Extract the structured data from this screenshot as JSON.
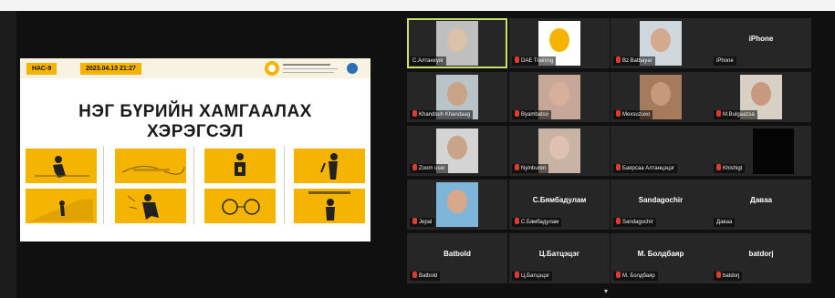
{
  "slide": {
    "tag_left": "НАС-9",
    "tag_date": "2023.04.13 21:27",
    "title_line1": "НЭГ БҮРИЙН ХАМГААЛАХ",
    "title_line2": "ХЭРЭГСЭЛ"
  },
  "participants": [
    {
      "label": "С.Алтанхуяг",
      "muted": false,
      "video": true
    },
    {
      "label": "DAE Training",
      "muted": true,
      "video": true
    },
    {
      "label": "Bz Batbayar",
      "muted": true,
      "video": true
    },
    {
      "label": "iPhone",
      "muted": false,
      "video": false,
      "name": "iPhone"
    },
    {
      "label": "Khandsuh Khandaag",
      "muted": true,
      "video": true
    },
    {
      "label": "Byambatso",
      "muted": true,
      "video": true
    },
    {
      "label": "Mexsuzuxo",
      "muted": true,
      "video": true
    },
    {
      "label": "M.Bulgaazsa",
      "muted": true,
      "video": true
    },
    {
      "label": "Zoom user",
      "muted": true,
      "video": true
    },
    {
      "label": "Nyinburen",
      "muted": true,
      "video": true
    },
    {
      "label": "Баярсаа Алтанцэцэг",
      "muted": true,
      "video": false
    },
    {
      "label": "Khishigt",
      "muted": true,
      "video": true
    },
    {
      "label": "Jepal",
      "muted": true,
      "video": true
    },
    {
      "label": "С.Бямбадулам",
      "muted": true,
      "video": false,
      "name": "С.Бямбадулам"
    },
    {
      "label": "Sandagochir",
      "muted": true,
      "video": false,
      "name": "Sandagochir"
    },
    {
      "label": "Давaa",
      "muted": false,
      "video": false,
      "name": "Давaa"
    },
    {
      "label": "Batbold",
      "muted": true,
      "video": false,
      "name": "Batbold"
    },
    {
      "label": "Ц.Батцэцэг",
      "muted": true,
      "video": false,
      "name": "Ц.Батцэцэг"
    },
    {
      "label": "М. Болдбаяр",
      "muted": true,
      "video": false,
      "name": "М. Болдбаяр"
    },
    {
      "label": "batdorj",
      "muted": true,
      "video": false,
      "name": "batdorj"
    }
  ],
  "icons": {
    "mute": "mic-muted-icon",
    "expand": "chevron-down-icon"
  },
  "colors": {
    "accent": "#f5b400",
    "active_speaker": "#c9e36a",
    "mute": "#e03a2f"
  }
}
